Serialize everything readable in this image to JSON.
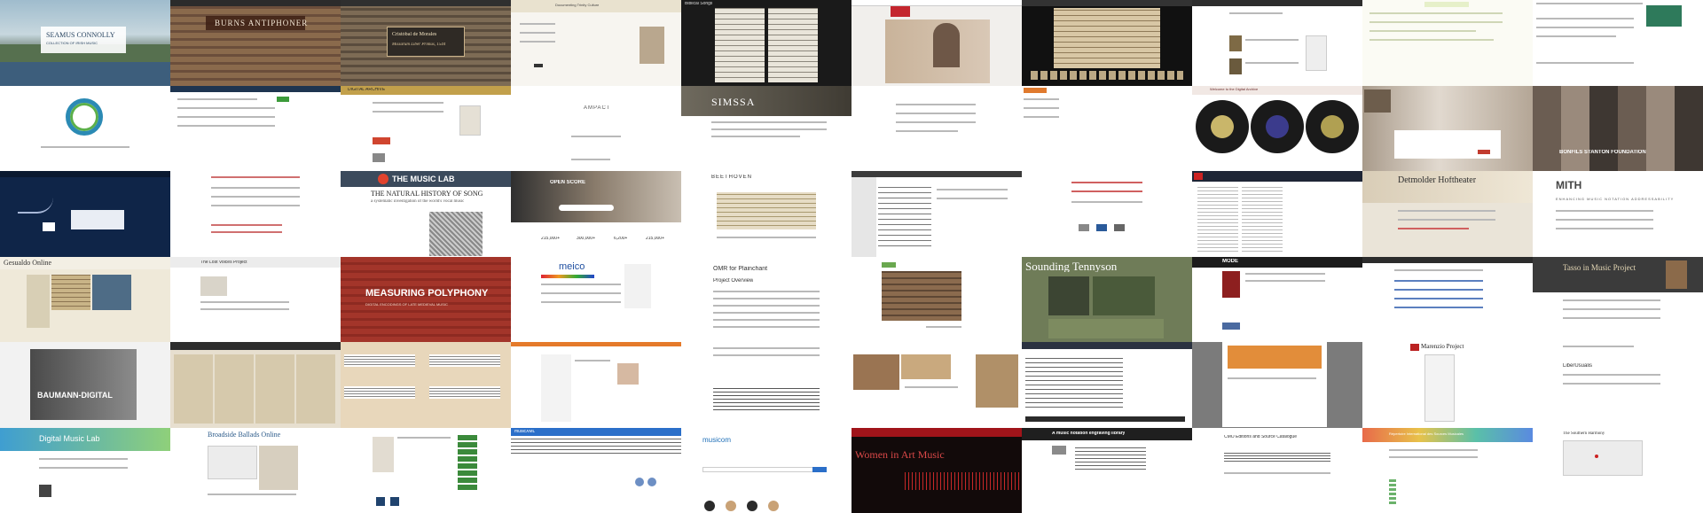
{
  "tiles": {
    "r0c0": {
      "title": "SEAMUS CONNOLLY",
      "subtitle": "COLLECTION OF IRISH MUSIC"
    },
    "r0c1": {
      "title": "BURNS ANTIPHONER"
    },
    "r0c2": {
      "title": "Cristóbal de Morales",
      "subtitle": "Missarum Liber Primus, 1544"
    },
    "r0c3": {
      "title": "Documenting Trinity Culture"
    },
    "r0c4": {
      "title": "Biblical Songs"
    },
    "r1c2": {
      "title": "DIGITAL ARCHIVE"
    },
    "r1c3": {
      "title": "AMPACT"
    },
    "r1c4": {
      "title": "SIMSSA"
    },
    "r1c7": {
      "title": "Welcome to the Digital Archive"
    },
    "r1c9": {
      "title": "BONFILS STANTON FOUNDATION"
    },
    "r2c2": {
      "title": "THE MUSIC LAB",
      "subtitle": "THE NATURAL HISTORY OF SONG",
      "tagline": "a systematic investigation of the world's vocal music"
    },
    "r2c3": {
      "title": "OPEN SCORE",
      "stats": [
        "215,000+",
        "300,000+",
        "6,200+",
        "215,000+"
      ]
    },
    "r2c4": {
      "title": "BEETHOVEN"
    },
    "r2c8": {
      "title": "Detmolder Hoftheater"
    },
    "r2c9": {
      "title": "MITH",
      "subtitle": "ENHANCING MUSIC NOTATION ADDRESSABILITY"
    },
    "r3c0": {
      "title": "Gesualdo Online"
    },
    "r3c1": {
      "title": "The Lost Voices Project"
    },
    "r3c2": {
      "title": "MEASURING POLYPHONY",
      "subtitle": "DIGITAL ENCODINGS OF LATE MEDIEVAL MUSIC"
    },
    "r3c3": {
      "title": "meico"
    },
    "r3c4": {
      "title": "OMR for Plainchant",
      "subtitle": "Project Overview"
    },
    "r3c6": {
      "title": "Sounding Tennyson"
    },
    "r3c7": {
      "title": "MODE"
    },
    "r3c9": {
      "title": "Tasso in Music Project"
    },
    "r4c0": {
      "title": "BAUMANN-DIGITAL"
    },
    "r4c8": {
      "title": "Marenzio Project"
    },
    "r4c9": {
      "title": "LiberUsualis"
    },
    "r5c0": {
      "title": "Digital Music Lab"
    },
    "r5c1": {
      "title": "Broadside Ballads Online"
    },
    "r5c3": {
      "title": "musicXML"
    },
    "r5c4": {
      "title": "musicom"
    },
    "r5c5": {
      "title": "Women in Art Music"
    },
    "r5c6": {
      "title": "A music notation engraving library"
    },
    "r5c7": {
      "title": "CMO Editions and Source Catalogue"
    },
    "r5c8": {
      "title": "Répertoire International des Sources Musicales"
    },
    "r5c9": {
      "title": "The Southern Harmony"
    }
  }
}
